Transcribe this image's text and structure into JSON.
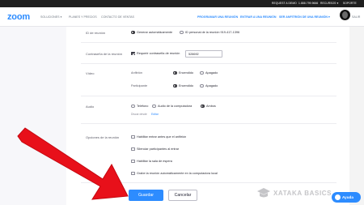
{
  "topbar": {
    "demo": "REQUEST A DEMO",
    "phone": "1.888.799.9666",
    "resources": "RECURSOS ▾",
    "support": "SOPORTE"
  },
  "header": {
    "logo": "zoom",
    "nav": [
      "SOLUCIONES ▾",
      "PLANES Y PRECIOS",
      "CONTACTO DE VENTAS"
    ],
    "actions": [
      "PROGRAMAR UNA REUNIÓN",
      "ENTRAR A UNA REUNIÓN",
      "SER ANFITRIÓN DE UNA REUNIÓN ▾"
    ],
    "user_label": "SALIR"
  },
  "meeting_id": {
    "label": "ID de reunión",
    "opt_auto": "Generar automáticamente",
    "opt_personal": "ID personal de la reunión 919-417-1396"
  },
  "password": {
    "label": "Contraseña de la reunión",
    "check_label": "Requerir contraseña de reunión",
    "value": "528692"
  },
  "video": {
    "label": "Vídeo",
    "host_label": "Anfitrión",
    "participant_label": "Participante",
    "on": "Encendido",
    "off": "Apagado"
  },
  "audio": {
    "label": "Audio",
    "phone": "Teléfono",
    "computer": "Audio de la computadora",
    "both": "Ambos",
    "dialin_from": "Discar desde",
    "dialin_edit": "Editar"
  },
  "options": {
    "label": "Opciones de la reunión",
    "items": [
      "Habilitar entrar antes que el anfitrión",
      "Silenciar participantes al entrar",
      "Habilitar la sala de espera",
      "Grabe la reunión automáticamente en la computadora local"
    ]
  },
  "buttons": {
    "save": "Guardar",
    "cancel": "Cancelar"
  },
  "watermark": "XATAKA BASICS",
  "help": "Ayuda",
  "colors": {
    "accent": "#2d8cff",
    "arrow": "#e8101a"
  }
}
